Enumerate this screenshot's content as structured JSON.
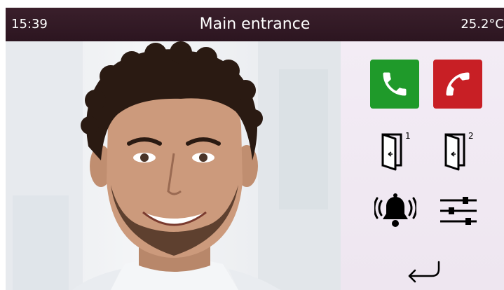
{
  "status_bar": {
    "time": "15:39",
    "title": "Main entrance",
    "temperature": "25.2°C"
  },
  "video_feed": {
    "subject": "visitor-face"
  },
  "controls": {
    "accept_call": {
      "icon": "phone-icon",
      "color": "#1f9a2a"
    },
    "reject_call": {
      "icon": "phone-hangup-icon",
      "color": "#c81f25"
    },
    "door_1": {
      "icon": "door-open-icon",
      "number": "1"
    },
    "door_2": {
      "icon": "door-open-icon",
      "number": "2"
    },
    "alarm": {
      "icon": "bell-ringing-icon"
    },
    "settings": {
      "icon": "sliders-icon"
    },
    "back": {
      "icon": "return-arrow-icon"
    }
  },
  "colors": {
    "status_bar": "#2c1520",
    "panel": "#f0e8f2"
  }
}
